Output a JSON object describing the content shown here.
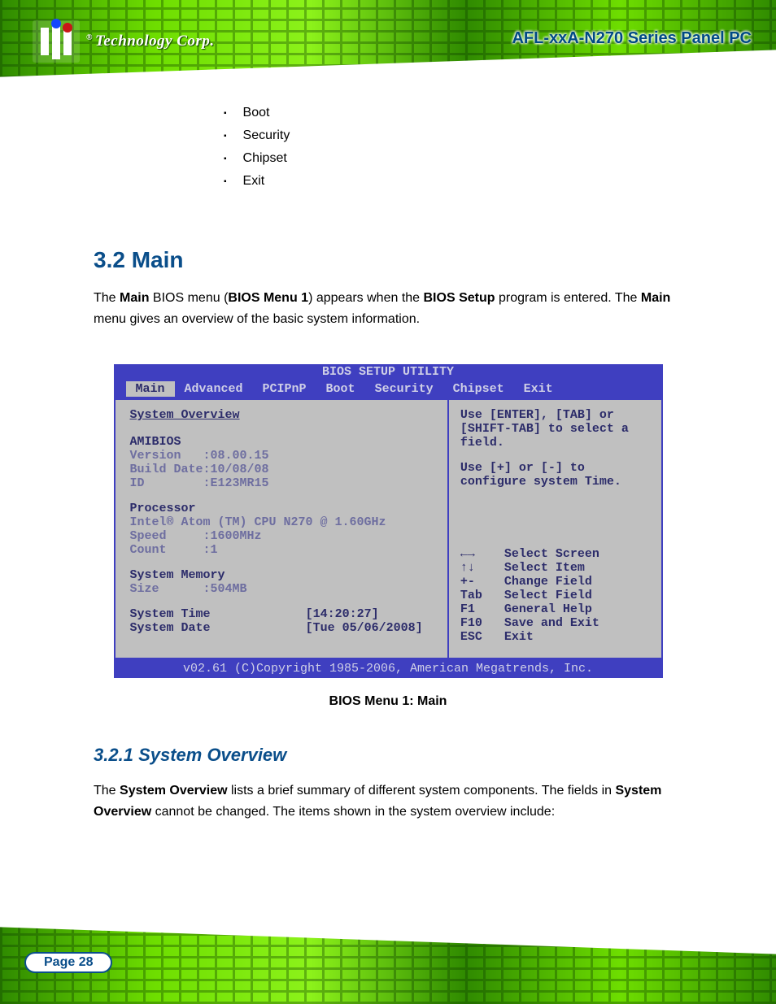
{
  "brand": "Technology Corp.",
  "doc_title": "AFL-xxA-N270 Series Panel PC",
  "features": [
    "Boot",
    "Security",
    "Chipset",
    "Exit"
  ],
  "section3_2": {
    "num": "3.2",
    "title": "Main",
    "body_1": "The ",
    "body_bold": "Main",
    "body_2": " BIOS menu (",
    "body_link": "BIOS Menu 1",
    "body_3": ") appears when the ",
    "body_bold2": "BIOS Setup",
    "body_4": " program is entered. The ",
    "body_bold3": "Main",
    "body_5": " menu gives an overview of the basic system information."
  },
  "caption": "BIOS Menu 1: Main",
  "chart_data": {
    "type": "table",
    "title": "BIOS SETUP UTILITY",
    "tabs": [
      "Main",
      "Advanced",
      "PCIPnP",
      "Boot",
      "Security",
      "Chipset",
      "Exit"
    ],
    "active_tab": "Main",
    "left_heading": "System Overview",
    "amibios": {
      "label": "AMIBIOS",
      "Version": "08.00.15",
      "Build Date": "10/08/08",
      "ID": "E123MR15"
    },
    "processor": {
      "label": "Processor",
      "name": "Intel® Atom (TM) CPU N270 @ 1.60GHz",
      "Speed": "1600MHz",
      "Count": "1"
    },
    "memory": {
      "label": "System Memory",
      "Size": "504MB"
    },
    "time": {
      "label": "System Time",
      "value": "[14:20:27]"
    },
    "date": {
      "label": "System Date",
      "value": "[Tue 05/06/2008]"
    },
    "help1": "Use [ENTER], [TAB] or [SHIFT-TAB] to select a field.",
    "help2": "Use [+] or [-] to configure system Time.",
    "keys": [
      {
        "k": "←→",
        "a": "Select Screen"
      },
      {
        "k": "↑↓",
        "a": "Select Item"
      },
      {
        "k": "+-",
        "a": "Change Field"
      },
      {
        "k": "Tab",
        "a": "Select Field"
      },
      {
        "k": "F1",
        "a": "General Help"
      },
      {
        "k": "F10",
        "a": "Save and Exit"
      },
      {
        "k": "ESC",
        "a": "Exit"
      }
    ],
    "footer": "v02.61 (C)Copyright 1985-2006, American Megatrends, Inc."
  },
  "section3_2_1": {
    "num": "3.2.1",
    "title": "System Overview",
    "body_1": "The ",
    "body_bold": "System Overview",
    "body_2": " lists a brief summary of different system components. The fields in ",
    "body_bold2": "System Overview",
    "body_3": " cannot be changed. The items shown in the system overview include:"
  },
  "page": "Page 28"
}
